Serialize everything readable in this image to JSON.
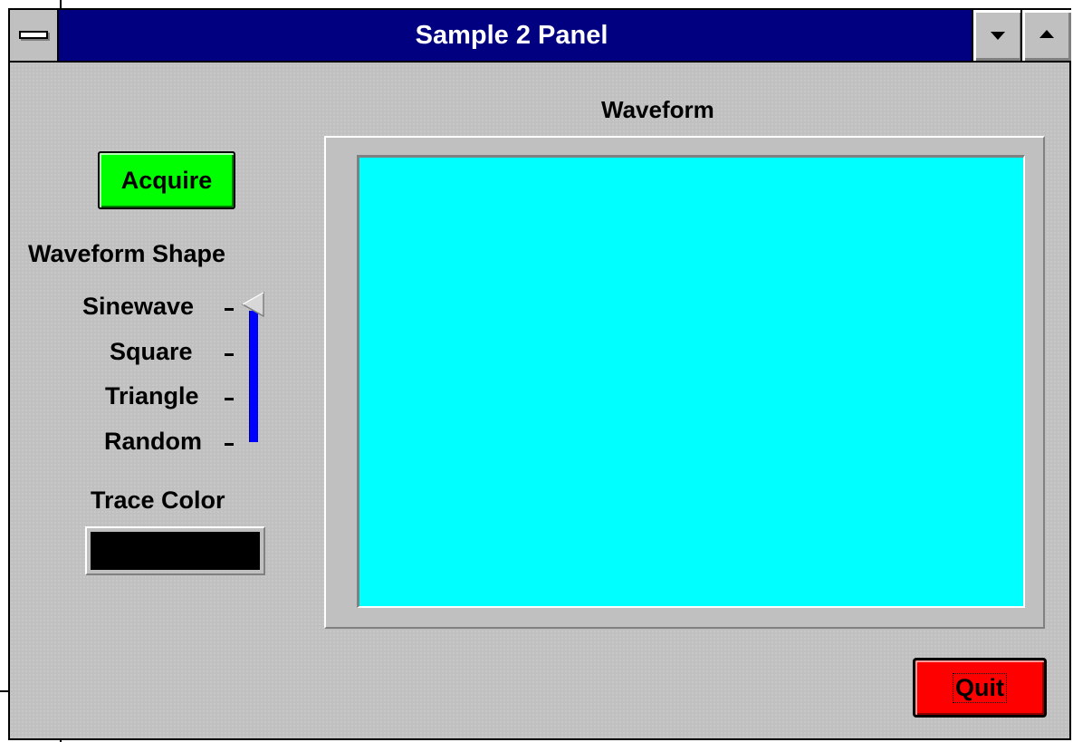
{
  "window": {
    "title": "Sample 2 Panel"
  },
  "controls": {
    "acquire_label": "Acquire",
    "waveform_shape_label": "Waveform Shape",
    "shape_options": [
      "Sinewave",
      "Square",
      "Triangle",
      "Random"
    ],
    "selected_shape": "Sinewave",
    "trace_color_label": "Trace Color",
    "trace_color_value": "#000000"
  },
  "graph": {
    "title": "Waveform",
    "plot_background": "#00ffff"
  },
  "footer": {
    "quit_label": "Quit"
  },
  "colors": {
    "titlebar": "#000080",
    "panel": "#c0c0c0",
    "acquire_button": "#00ff00",
    "quit_button": "#ff0000",
    "slider_track": "#0000ff"
  },
  "icons": {
    "system_menu": "system-menu-icon",
    "minimize": "minimize-arrow-icon",
    "maximize": "maximize-arrow-icon",
    "slider_pointer": "slider-pointer-icon"
  }
}
